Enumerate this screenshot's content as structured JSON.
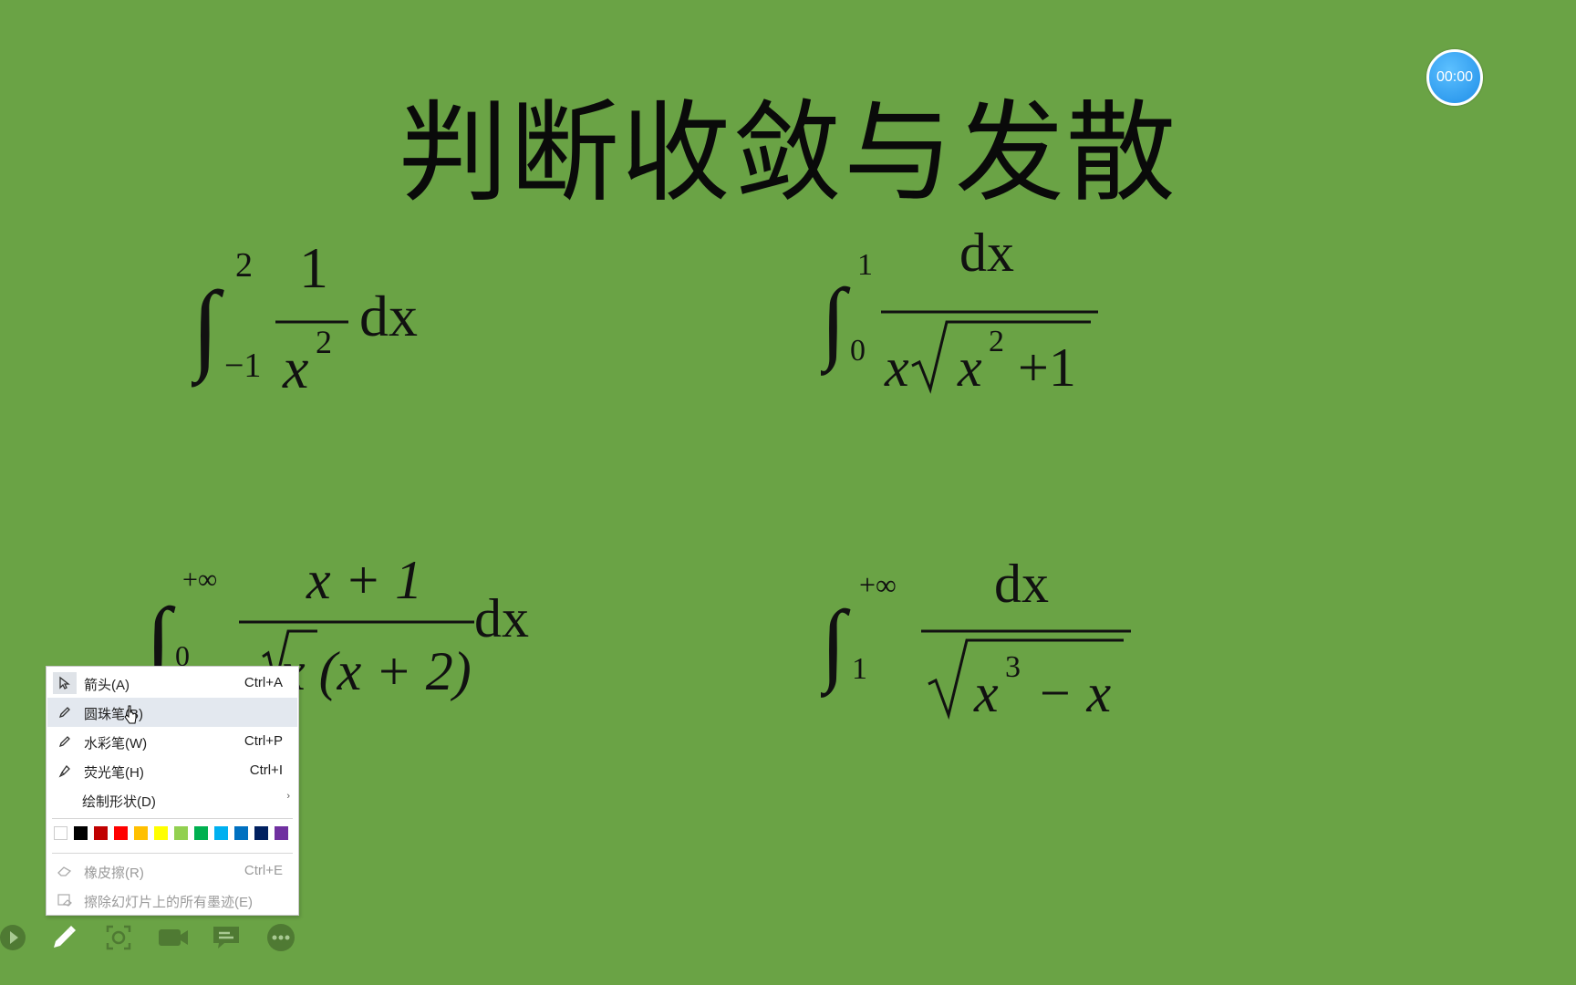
{
  "slide": {
    "title": "判断收敛与发散",
    "timer": "00:00"
  },
  "formulas": {
    "f1": {
      "int": "∫",
      "upper": "2",
      "lower": "−1",
      "num": "1",
      "den_x": "x",
      "den_exp": "2",
      "tail": "dx"
    },
    "f2": {
      "int": "∫",
      "upper": "1",
      "lower": "0",
      "num": "dx",
      "den_x": "x",
      "rad_x": "x",
      "rad_exp": "2",
      "rad_tail": "+1"
    },
    "f3": {
      "int": "∫",
      "upper": "+∞",
      "lower": "0",
      "num": "x + 1",
      "den": "x (x + 2)",
      "tail": "dx"
    },
    "f4": {
      "int": "∫",
      "upper": "+∞",
      "lower": "1",
      "num": "dx",
      "rad_x": "x",
      "rad_exp": "3",
      "rad_tail": "− x"
    }
  },
  "context_menu": {
    "items": [
      {
        "label": "箭头(A)",
        "shortcut": "Ctrl+A",
        "icon": "arrow-pointer-icon",
        "disabled": false
      },
      {
        "label": "圆珠笔(B)",
        "shortcut": "",
        "icon": "ballpoint-pen-icon",
        "disabled": false
      },
      {
        "label": "水彩笔(W)",
        "shortcut": "Ctrl+P",
        "icon": "felt-pen-icon",
        "disabled": false
      },
      {
        "label": "荧光笔(H)",
        "shortcut": "Ctrl+I",
        "icon": "highlighter-icon",
        "disabled": false
      },
      {
        "label": "绘制形状(D)",
        "shortcut": "",
        "icon": "",
        "disabled": false
      },
      {
        "label": "橡皮擦(R)",
        "shortcut": "Ctrl+E",
        "icon": "eraser-icon",
        "disabled": true
      },
      {
        "label": "擦除幻灯片上的所有墨迹(E)",
        "shortcut": "",
        "icon": "erase-all-ink-icon",
        "disabled": true
      }
    ],
    "submenu_arrow": "›",
    "colors": [
      "#ffffff",
      "#000000",
      "#c00000",
      "#ff0000",
      "#ffc000",
      "#ffff00",
      "#92d050",
      "#00b050",
      "#00b0f0",
      "#0070c0",
      "#002060",
      "#7030a0"
    ]
  },
  "toolbar": {
    "buttons": [
      "play-icon",
      "pen-icon",
      "focus-icon",
      "camera-icon",
      "subtitle-icon",
      "more-icon"
    ]
  }
}
